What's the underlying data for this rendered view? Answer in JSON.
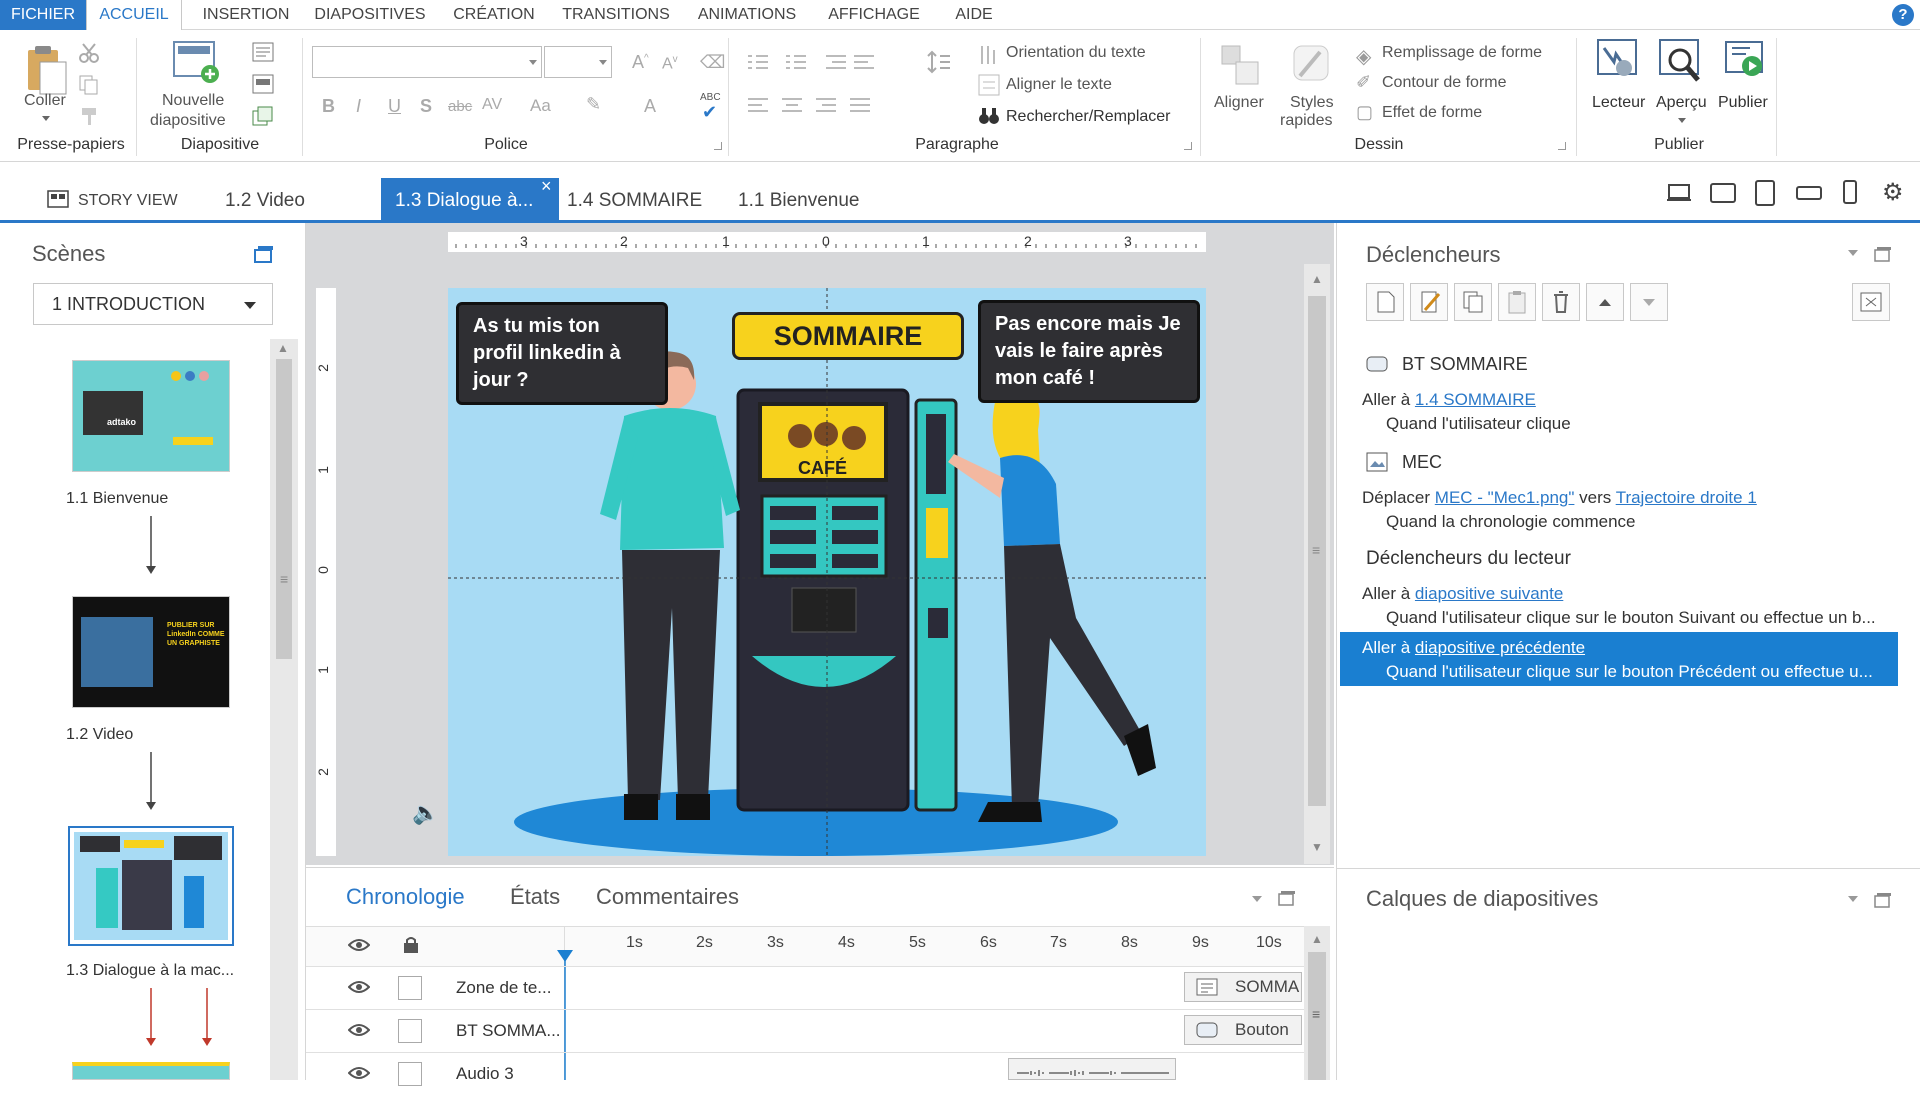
{
  "menubar": {
    "items": [
      "FICHIER",
      "ACCUEIL",
      "INSERTION",
      "DIAPOSITIVES",
      "CRÉATION",
      "TRANSITIONS",
      "ANIMATIONS",
      "AFFICHAGE",
      "AIDE"
    ],
    "help": "?"
  },
  "ribbon": {
    "presse": {
      "coller": "Coller",
      "label": "Presse-papiers"
    },
    "diapositive": {
      "nouvelle1": "Nouvelle",
      "nouvelle2": "diapositive",
      "label": "Diapositive"
    },
    "police": {
      "label": "Police",
      "bold": "B",
      "italic": "I",
      "underline": "U",
      "shadow": "S",
      "strike": "abc",
      "spacing": "AV",
      "case": "Aa",
      "color": "A",
      "spell": "ABC"
    },
    "paragraphe": {
      "orientation": "Orientation du texte",
      "aligner_texte": "Aligner le texte",
      "rechercher": "Rechercher/Remplacer",
      "label": "Paragraphe"
    },
    "dessin": {
      "aligner": "Aligner",
      "styles1": "Styles",
      "styles2": "rapides",
      "remplissage": "Remplissage de forme",
      "contour": "Contour de forme",
      "effet": "Effet de forme",
      "label": "Dessin"
    },
    "publier": {
      "lecteur": "Lecteur",
      "apercu": "Aperçu",
      "publier": "Publier",
      "label": "Publier"
    }
  },
  "tabs": {
    "story": "STORY VIEW",
    "t1": "1.2 Video",
    "active": "1.3 Dialogue à...",
    "t3": "1.4 SOMMAIRE",
    "t4": "1.1 Bienvenue",
    "close": "×"
  },
  "scenes": {
    "title": "Scènes",
    "selected": "1 INTRODUCTION",
    "slides": [
      {
        "caption": "1.1 Bienvenue"
      },
      {
        "caption": "1.2 Video"
      },
      {
        "caption": "1.3 Dialogue à la mac..."
      }
    ],
    "thumb1_text": "adtako",
    "thumb2_text": "PUBLIER SUR LinkedIn COMME UN GRAPHISTE"
  },
  "ruler": {
    "h_labels": [
      "3",
      "2",
      "1",
      "0",
      "1",
      "2",
      "3"
    ],
    "v_labels": [
      "2",
      "1",
      "0",
      "1",
      "2"
    ]
  },
  "slide": {
    "bubble_left": "As tu mis ton profil linkedin à jour ?",
    "sommaire": "SOMMAIRE",
    "bubble_right": "Pas encore mais Je vais le faire après mon café !",
    "cafe": "CAFÉ"
  },
  "triggers": {
    "title": "Déclencheurs",
    "groups": [
      {
        "name": "BT SOMMAIRE",
        "action": "Aller à",
        "target": "1.4 SOMMAIRE",
        "when": "Quand l'utilisateur clique"
      },
      {
        "name": "MEC",
        "action": "Déplacer",
        "target": "MEC - \"Mec1.png\"",
        "vers": "vers",
        "path": "Trajectoire droite 1",
        "when": "Quand la chronologie commence"
      }
    ],
    "player_title": "Déclencheurs du lecteur",
    "player": [
      {
        "action": "Aller à",
        "target": "diapositive suivante",
        "when": "Quand l'utilisateur clique sur le bouton Suivant ou effectue un b..."
      },
      {
        "action": "Aller à",
        "target": "diapositive précédente",
        "when": "Quand l'utilisateur clique sur le bouton Précédent ou effectue u..."
      }
    ]
  },
  "layers": {
    "title": "Calques de diapositives"
  },
  "timeline": {
    "tabs": [
      "Chronologie",
      "États",
      "Commentaires"
    ],
    "ticks": [
      "1s",
      "2s",
      "3s",
      "4s",
      "5s",
      "6s",
      "7s",
      "8s",
      "9s",
      "10s"
    ],
    "rows": [
      {
        "name": "Zone de te...",
        "bar": "SOMMA"
      },
      {
        "name": "BT SOMMA...",
        "bar": "Bouton"
      },
      {
        "name": "Audio 3",
        "bar": ""
      }
    ]
  },
  "colors": {
    "accent": "#2a78c8",
    "slide_bg": "#a8dbf4",
    "bubble": "#2f2f33",
    "yellow": "#f7d21d",
    "teal": "#34c7c1"
  }
}
